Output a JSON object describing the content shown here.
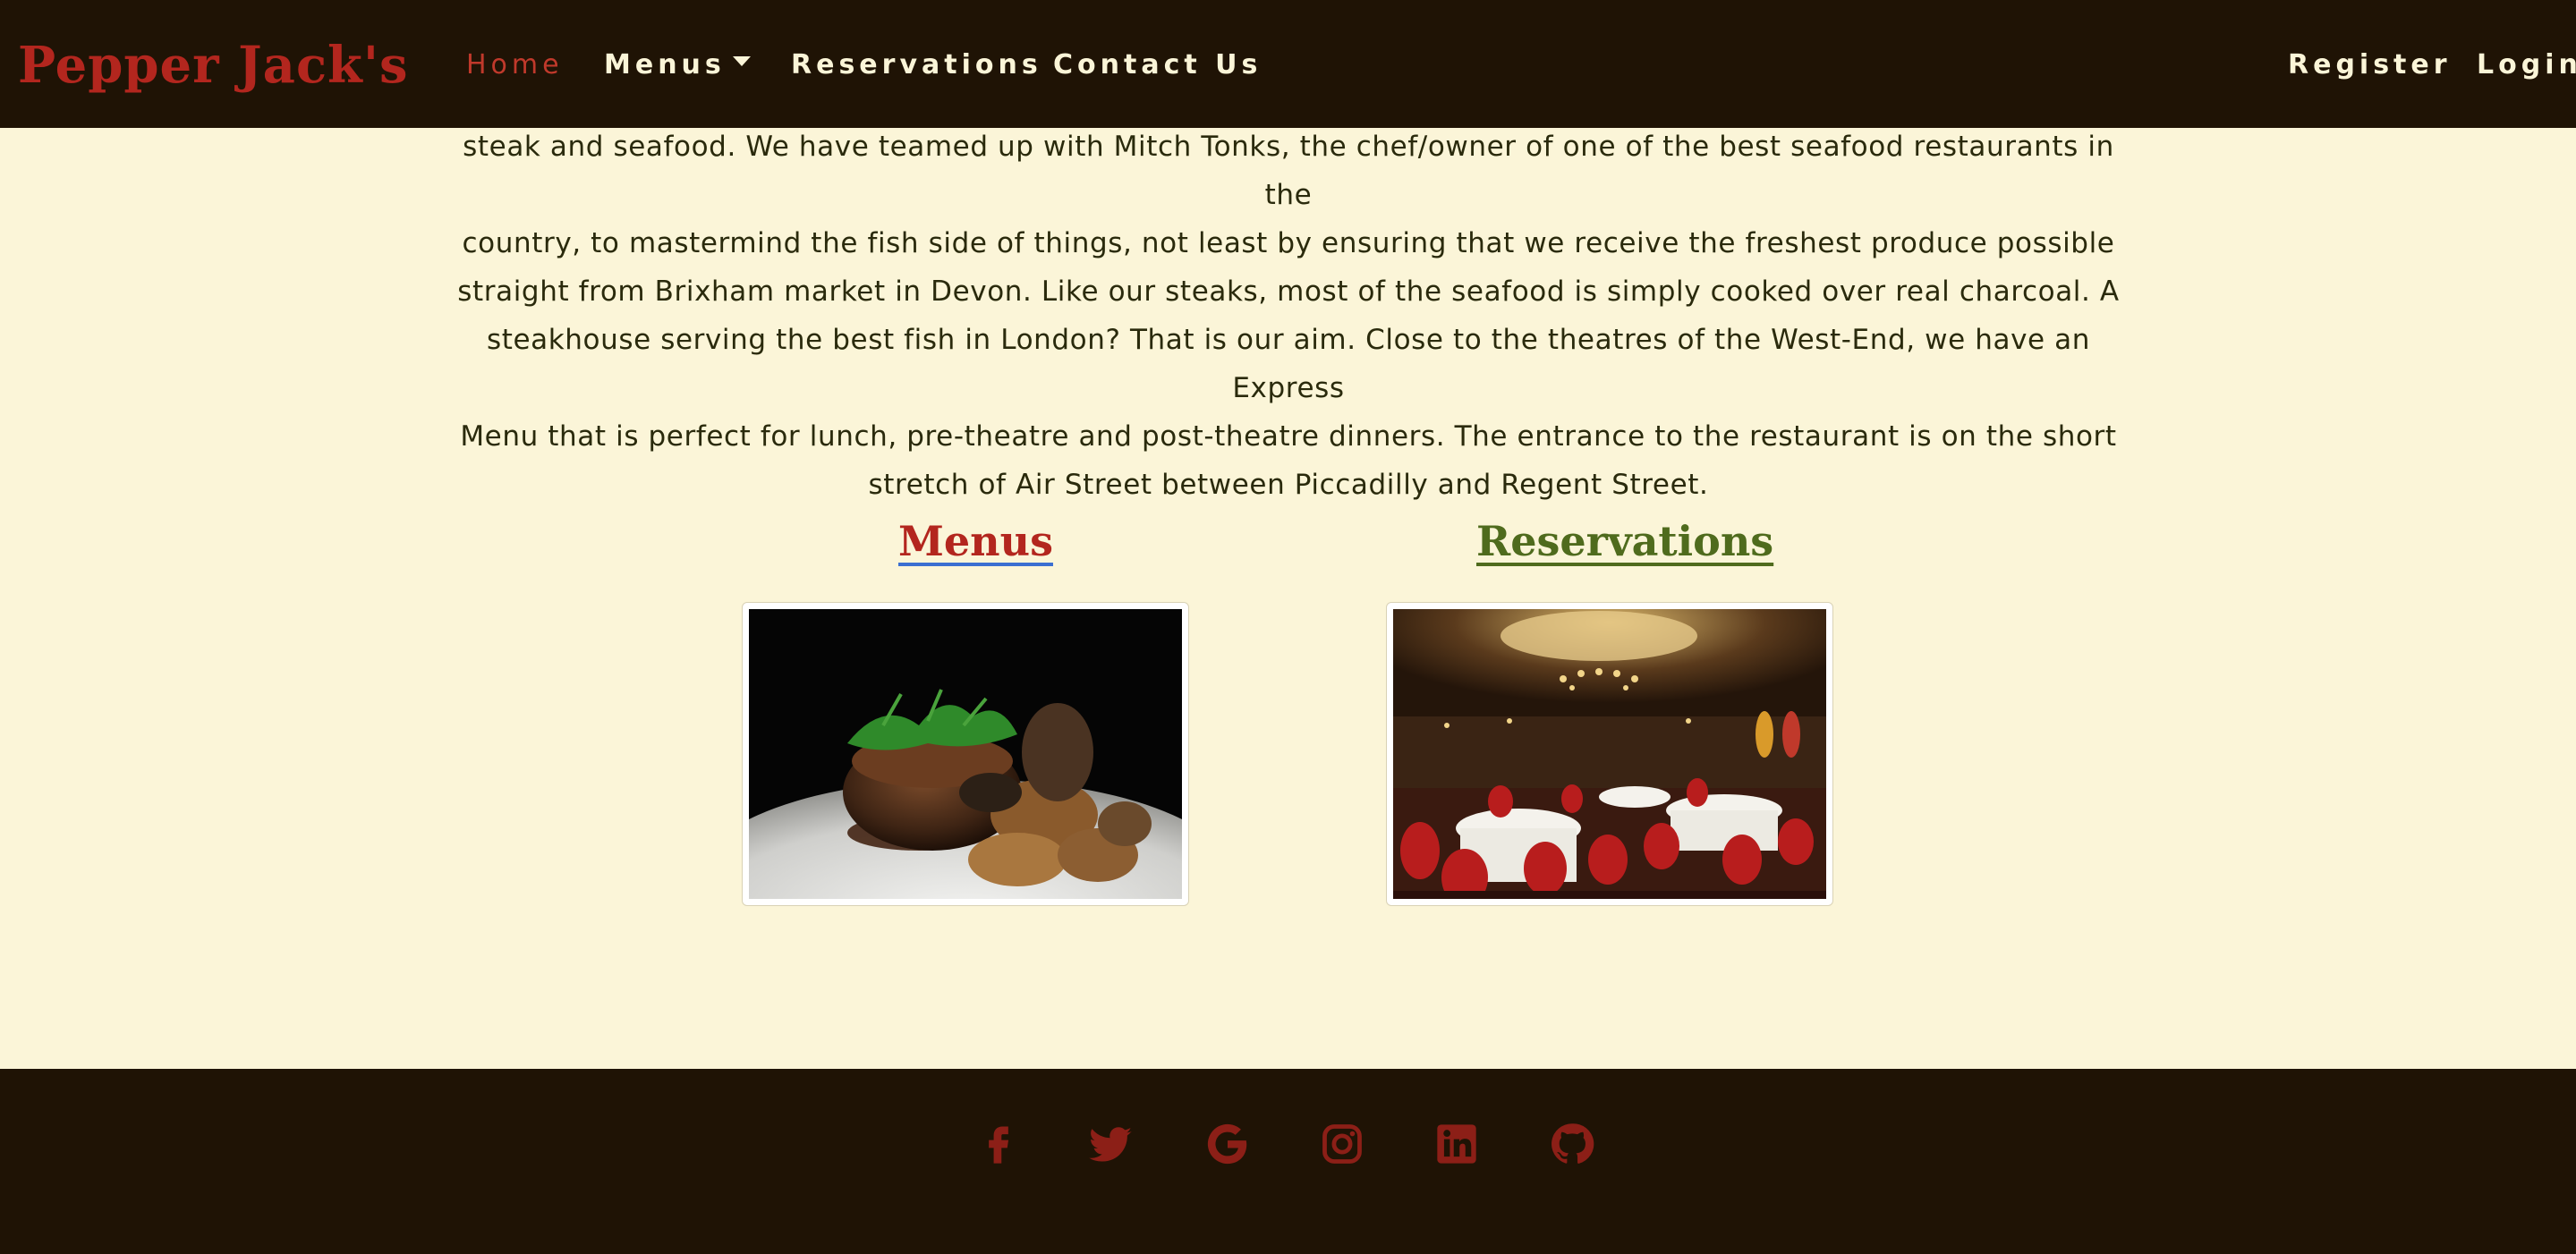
{
  "brand": "Pepper Jack's",
  "nav": {
    "home": "Home",
    "menus": "Menus",
    "reservations": "Reservations",
    "contact": "Contact Us",
    "register": "Register",
    "login": "Login"
  },
  "intro": {
    "lines": [
      "steak and seafood. We have teamed up with Mitch Tonks, the chef/owner of one of the best seafood restaurants in the",
      "country, to mastermind the fish side of things, not least by ensuring that we receive the freshest produce possible",
      "straight from Brixham market in Devon. Like our steaks, most of the seafood is simply cooked over real charcoal. A",
      "steakhouse serving the best fish in London? That is our aim. Close to the theatres of the West-End, we have an Express",
      "Menu that is perfect for lunch, pre-theatre and post-theatre dinners. The entrance to the restaurant is on the short",
      "stretch of Air Street between Piccadilly and Regent Street."
    ]
  },
  "cards": {
    "menus": {
      "title": "Menus",
      "image_icon": "steak-dish-photo"
    },
    "reservations": {
      "title": "Reservations",
      "image_icon": "dining-room-photo"
    }
  },
  "footer": {
    "social": [
      "facebook-icon",
      "twitter-icon",
      "google-icon",
      "instagram-icon",
      "linkedin-icon",
      "github-icon"
    ]
  },
  "colors": {
    "background": "#fbf5d8",
    "nav_bg": "#1f1305",
    "brand_red": "#b3261e",
    "active_link": "#c0392b",
    "reservations_green": "#4f6b1d",
    "social_icon": "#8c1f17"
  }
}
